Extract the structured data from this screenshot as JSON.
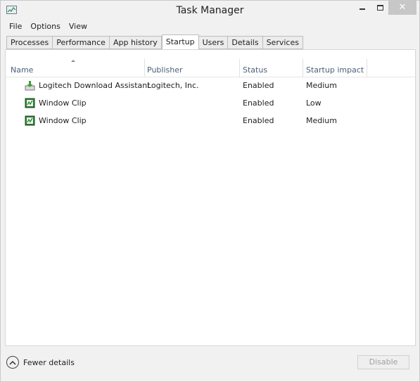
{
  "window": {
    "title": "Task Manager",
    "close_glyph": "✕"
  },
  "menu": [
    "File",
    "Options",
    "View"
  ],
  "tabs": [
    {
      "label": "Processes",
      "active": false
    },
    {
      "label": "Performance",
      "active": false
    },
    {
      "label": "App history",
      "active": false
    },
    {
      "label": "Startup",
      "active": true
    },
    {
      "label": "Users",
      "active": false
    },
    {
      "label": "Details",
      "active": false
    },
    {
      "label": "Services",
      "active": false
    }
  ],
  "table": {
    "sorted_column": "Name",
    "columns": [
      "Name",
      "Publisher",
      "Status",
      "Startup impact"
    ],
    "rows": [
      {
        "name": "Logitech Download Assistant",
        "publisher": "Logitech, Inc.",
        "status": "Enabled",
        "impact": "Medium",
        "icon": "download-assistant-icon"
      },
      {
        "name": "Window Clip",
        "publisher": "",
        "status": "Enabled",
        "impact": "Low",
        "icon": "window-clip-icon"
      },
      {
        "name": "Window Clip",
        "publisher": "",
        "status": "Enabled",
        "impact": "Medium",
        "icon": "window-clip-icon"
      }
    ]
  },
  "footer": {
    "fewer_details": "Fewer details",
    "disable": "Disable"
  }
}
